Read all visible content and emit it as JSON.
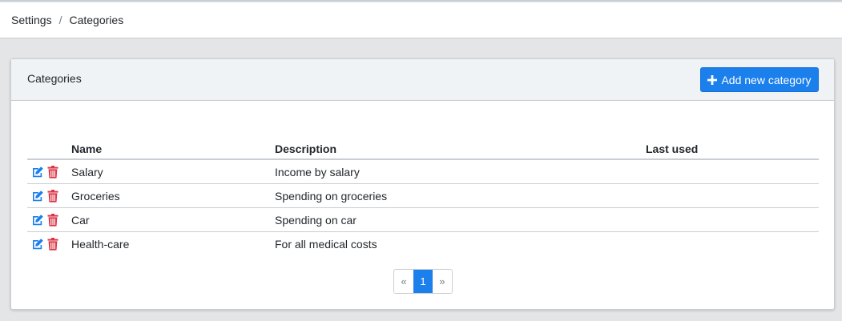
{
  "breadcrumb": {
    "items": [
      "Settings",
      "Categories"
    ],
    "separator": "/"
  },
  "card": {
    "title": "Categories",
    "add_button_label": "Add new category"
  },
  "table": {
    "columns": [
      "",
      "Name",
      "Description",
      "Last used"
    ],
    "rows": [
      {
        "name": "Salary",
        "description": "Income by salary",
        "last_used": ""
      },
      {
        "name": "Groceries",
        "description": "Spending on groceries",
        "last_used": ""
      },
      {
        "name": "Car",
        "description": "Spending on car",
        "last_used": ""
      },
      {
        "name": "Health-care",
        "description": "For all medical costs",
        "last_used": ""
      }
    ]
  },
  "pagination": {
    "prev": "«",
    "pages": [
      "1"
    ],
    "next": "»",
    "current": "1"
  },
  "icons": {
    "edit": "edit-icon",
    "delete": "trash-icon",
    "add": "plus-icon"
  },
  "colors": {
    "primary": "#1b7fec",
    "danger": "#dc3545",
    "edit": "#1b7fec"
  }
}
